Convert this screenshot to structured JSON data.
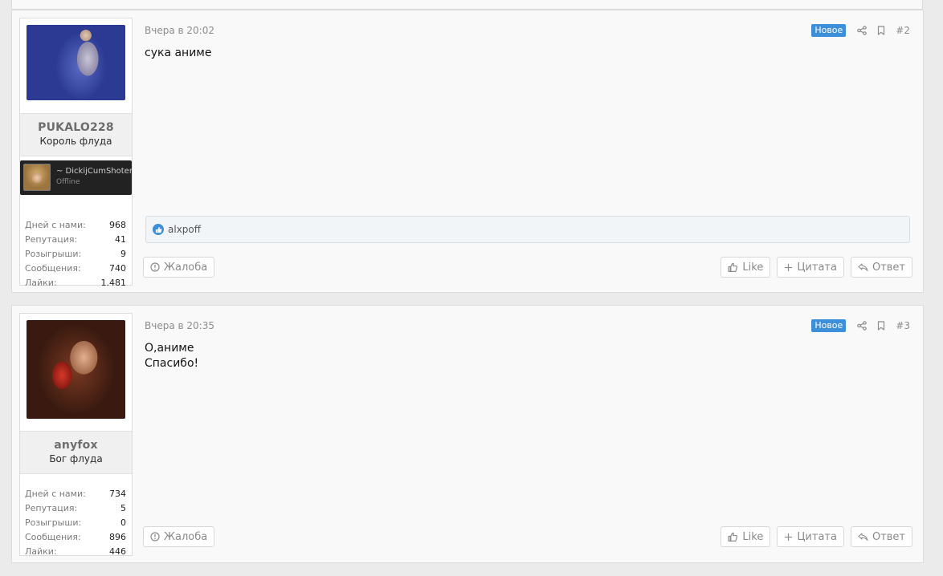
{
  "posts": [
    {
      "time": "Вчера в 20:02",
      "badge": "Новое",
      "number": "#2",
      "message": [
        "сука аниме"
      ],
      "user": {
        "name": "PUKALO228",
        "title": "Король флуда",
        "avatar": "avatar-female-fighter"
      },
      "banner": {
        "name": "~ DickijCumShoter",
        "status": "Offline"
      },
      "stats": [
        {
          "label": "Дней с нами:",
          "value": "968"
        },
        {
          "label": "Репутация:",
          "value": "41"
        },
        {
          "label": "Розыгрыши:",
          "value": "9"
        },
        {
          "label": "Сообщения:",
          "value": "740"
        },
        {
          "label": "Лайки:",
          "value": "1.481"
        }
      ],
      "reactions": {
        "users": "alxpoff"
      }
    },
    {
      "time": "Вчера в 20:35",
      "badge": "Новое",
      "number": "#3",
      "message": [
        "О,аниме",
        "Спасибо!"
      ],
      "user": {
        "name": "anyfox",
        "title": "Бог флуда",
        "avatar": "avatar-woman-mask"
      },
      "stats": [
        {
          "label": "Дней с нами:",
          "value": "734"
        },
        {
          "label": "Репутация:",
          "value": "5"
        },
        {
          "label": "Розыгрыши:",
          "value": "0"
        },
        {
          "label": "Сообщения:",
          "value": "896"
        },
        {
          "label": "Лайки:",
          "value": "446"
        }
      ]
    }
  ],
  "actions": {
    "report": "Жалоба",
    "like": "Like",
    "quote": "Цитата",
    "reply": "Ответ"
  },
  "icons": {
    "share": "share-icon",
    "bookmark": "bookmark-icon",
    "report": "alert-circle-icon",
    "like": "thumbs-up-icon",
    "quote": "plus-icon",
    "reply": "reply-icon"
  },
  "colors": {
    "badge": "#3d8fd9",
    "background": "#ebebeb",
    "post_bg": "#f9f9f9"
  }
}
